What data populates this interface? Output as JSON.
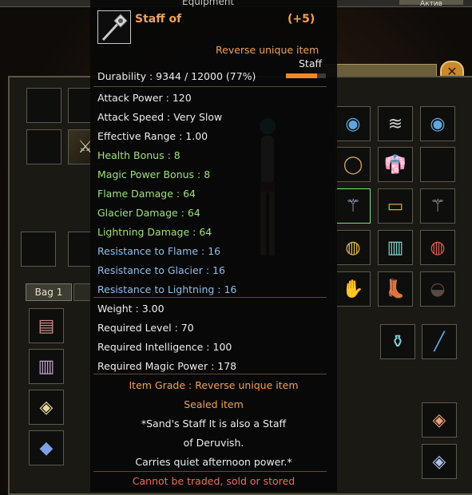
{
  "window": {
    "title": "Equipment",
    "top_right": "Актив"
  },
  "item": {
    "name": "Staff of",
    "enhance": "(+5)",
    "rarity_line": "Reverse unique item",
    "type": "Staff",
    "durability": "Durability : 9344 / 12000 (77%)",
    "durability_fraction": 0.77,
    "stats": [
      {
        "text": "Attack Power : 120",
        "color": "white"
      },
      {
        "text": "Attack Speed : Very Slow",
        "color": "white"
      },
      {
        "text": "Effective Range : 1.00",
        "color": "white"
      },
      {
        "text": "Health Bonus : 8",
        "color": "green"
      },
      {
        "text": "Magic Power Bonus : 8",
        "color": "green"
      },
      {
        "text": "Flame Damage : 64",
        "color": "green"
      },
      {
        "text": "Glacier Damage : 64",
        "color": "green"
      },
      {
        "text": "Lightning Damage : 64",
        "color": "green"
      },
      {
        "text": "Resistance to Flame : 16",
        "color": "blue"
      },
      {
        "text": "Resistance to Glacier : 16",
        "color": "blue"
      },
      {
        "text": "Resistance to Lightning : 16",
        "color": "blue"
      }
    ],
    "requirements": [
      "Weight : 3.00",
      "Required Level : 70",
      "Required Intelligence : 100",
      "Required Magic Power : 178"
    ],
    "grade_line": "Item Grade : Reverse unique item",
    "sealed": "Sealed item",
    "desc_lines": [
      "*Sand's Staff It is also a Staff",
      "of Deruvish.",
      "Carries quiet afternoon power.*"
    ],
    "restriction": "Cannot be traded, sold or stored"
  },
  "inventory": {
    "bag_tab": "Bag 1"
  },
  "colors": {
    "green": "#9fe07d",
    "blue": "#8fbfe6",
    "orange": "#f0a05a",
    "red": "#f26a5a"
  }
}
